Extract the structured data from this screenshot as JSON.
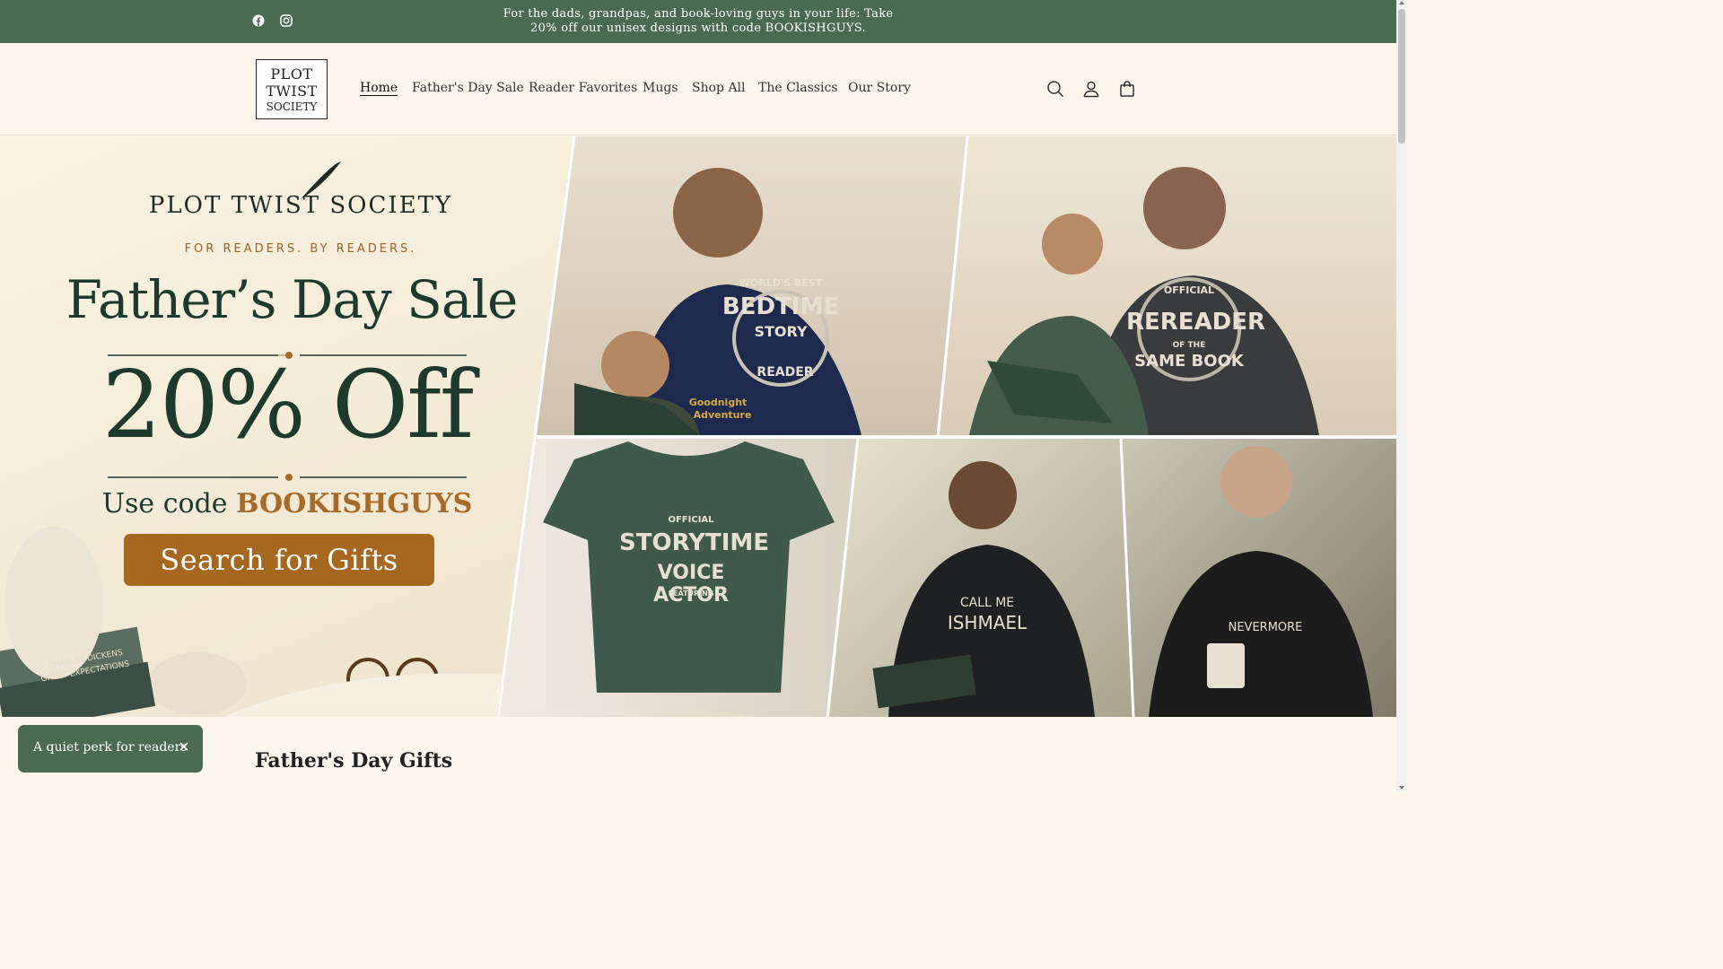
{
  "announcement": {
    "line1": "For the dads, grandpas, and book-loving guys in your life: Take",
    "line2": "20% off our unisex designs with code BOOKISHGUYS."
  },
  "social": {
    "facebook": "facebook-icon",
    "instagram": "instagram-icon"
  },
  "logo": {
    "line1": "PLOT",
    "line2": "TWIST",
    "line3": "SOCIETY"
  },
  "nav": {
    "items": [
      {
        "label": "Home",
        "active": true
      },
      {
        "label": "Father's Day Sale"
      },
      {
        "label": "Reader Favorites"
      },
      {
        "label": "Mugs"
      },
      {
        "label": "Shop All"
      },
      {
        "label": "The Classics"
      },
      {
        "label": "Our Story"
      }
    ]
  },
  "header_icons": [
    "search-icon",
    "account-icon",
    "cart-icon"
  ],
  "hero": {
    "brand": "PLOT TWIST SOCIETY",
    "brand_sub": "FOR READERS. BY READERS.",
    "title": "Father’s Day Sale",
    "discount": "20% Off",
    "code_prefix": "Use code",
    "code": "BOOKISHGUYS",
    "cta": "Search for Gifts",
    "shirts": {
      "bedtime": {
        "top": "WORLD'S BEST",
        "main": "BEDTIME",
        "sub": "STORY",
        "bottom": "READER"
      },
      "rereader": {
        "top": "OFFICIAL",
        "main": "REREADER",
        "sub": "OF THE",
        "bottom": "SAME BOOK"
      },
      "storytime": {
        "top": "OFFICIAL",
        "main": "STORYTIME",
        "sub": "VOICE ACTOR",
        "bottom": "FEATURING"
      },
      "ishmael": {
        "top": "CALL ME",
        "main": "ISHMAEL"
      },
      "nevermore": {
        "main": "NEVERMORE"
      }
    },
    "book_cover": {
      "title": "Goodnight",
      "subtitle": "Adventure"
    },
    "book_spine": {
      "author": "CHARLES DICKENS",
      "title": "GREAT EXPECTATIONS"
    }
  },
  "popup": {
    "text": "A quiet perk for readers"
  },
  "section": {
    "title": "Father's Day Gifts"
  },
  "colors": {
    "brand_green": "#4a6b51",
    "cta_brown": "#a6671f",
    "cream": "#fdf6ec"
  }
}
